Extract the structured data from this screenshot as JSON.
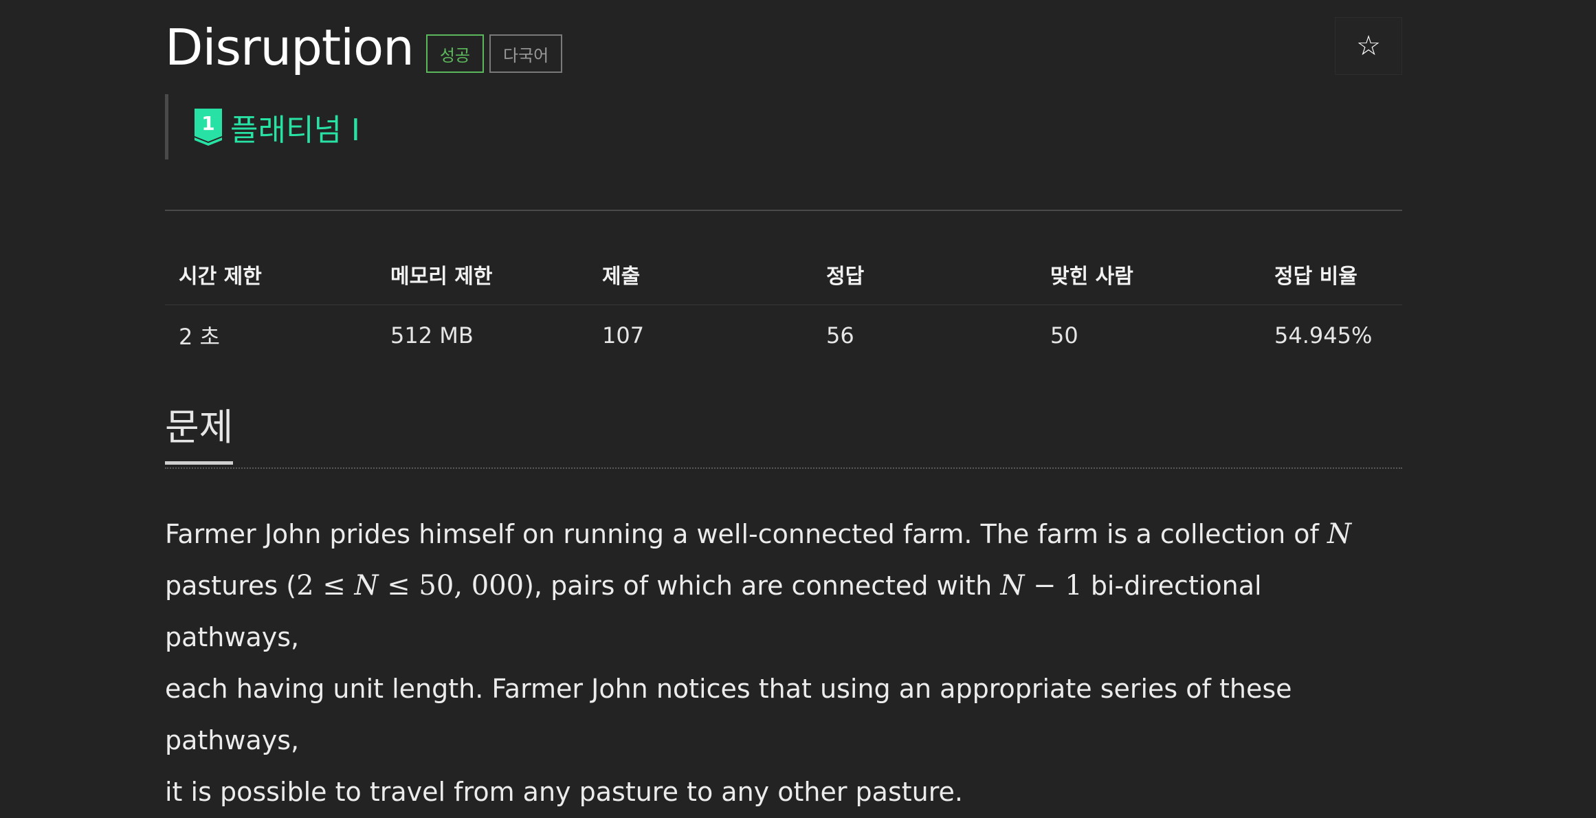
{
  "header": {
    "title": "Disruption",
    "badge_success": "성공",
    "badge_multilang": "다국어",
    "star_icon": "☆"
  },
  "tier": {
    "icon_number": "1",
    "label": "플래티넘 I",
    "color": "#27e2a4"
  },
  "info_table": {
    "headers": [
      "시간 제한",
      "메모리 제한",
      "제출",
      "정답",
      "맞힌 사람",
      "정답 비율"
    ],
    "values": [
      "2 초",
      "512 MB",
      "107",
      "56",
      "50",
      "54.945%"
    ]
  },
  "section": {
    "title": "문제"
  },
  "problem": {
    "line1_a": "Farmer John prides himself on running a well-connected farm. The farm is a collection of ",
    "math_n": "N",
    "line2_a": "pastures (",
    "math_range_a": "2 ≤ ",
    "math_range_n": "N",
    "math_range_b": " ≤ 50, 000",
    "line2_b": "), pairs of which are connected with ",
    "math_nm1_n": "N",
    "math_nm1_rest": " − 1",
    "line2_c": " bi-directional pathways,",
    "line3": "each having unit length. Farmer John notices that using an appropriate series of these pathways,",
    "line4": "it is possible to travel from any pasture to any other pasture."
  }
}
